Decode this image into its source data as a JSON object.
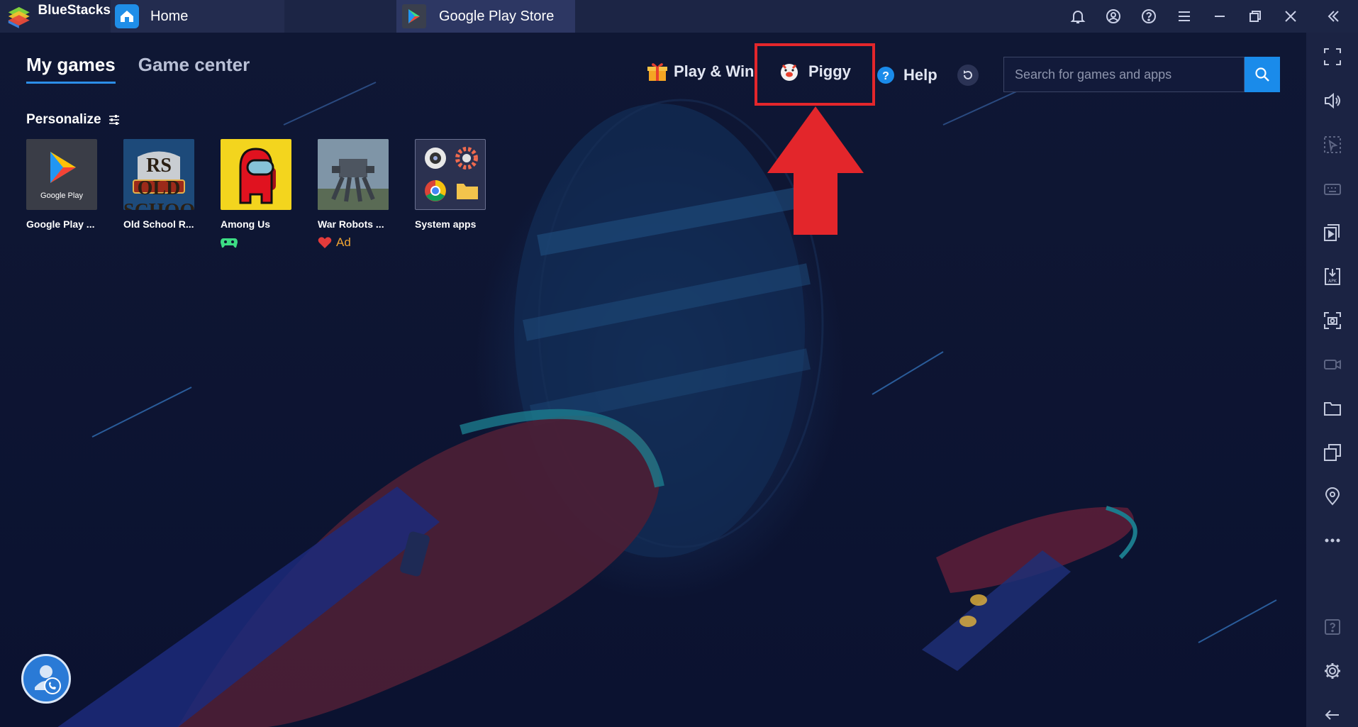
{
  "titlebar": {
    "app_name": "BlueStacks",
    "tabs": [
      {
        "label": "Home",
        "icon": "home-icon"
      },
      {
        "label": "Google Play Store",
        "icon": "google-play-icon"
      }
    ],
    "tools": [
      "bell-icon",
      "account-icon",
      "help-circle-icon",
      "menu-icon",
      "minimize-icon",
      "restore-icon",
      "close-icon",
      "collapse-icon"
    ]
  },
  "nav": {
    "my_games": "My games",
    "game_center": "Game center"
  },
  "personalize": {
    "label": "Personalize",
    "icon": "sliders-icon"
  },
  "games": [
    {
      "name": "Google Play ...",
      "thumb_label": "Google Play",
      "tag": ""
    },
    {
      "name": "Old School R...",
      "thumb_label": "RS OLD SCHOOL",
      "tag": ""
    },
    {
      "name": "Among Us",
      "thumb_label": "",
      "tag": "gamepad-icon"
    },
    {
      "name": "War Robots ...",
      "thumb_label": "",
      "tag": "Ad"
    },
    {
      "name": "System apps",
      "thumb_label": "",
      "tag": ""
    }
  ],
  "top_actions": {
    "play_win": "Play & Win",
    "piggy": "Piggy",
    "help": "Help"
  },
  "search": {
    "placeholder": "Search for games and apps"
  },
  "sidebar": [
    "fullscreen-icon",
    "volume-icon",
    "pointer-icon",
    "keyboard-icon",
    "media-manager-icon",
    "apk-install-icon",
    "screenshot-icon",
    "record-icon",
    "folder-icon",
    "multi-instance-icon",
    "location-icon",
    "more-icon",
    "question-icon",
    "settings-icon",
    "back-icon"
  ],
  "colors": {
    "accent": "#1a8bea",
    "highlight": "#e3262b",
    "background": "#0e1530"
  }
}
